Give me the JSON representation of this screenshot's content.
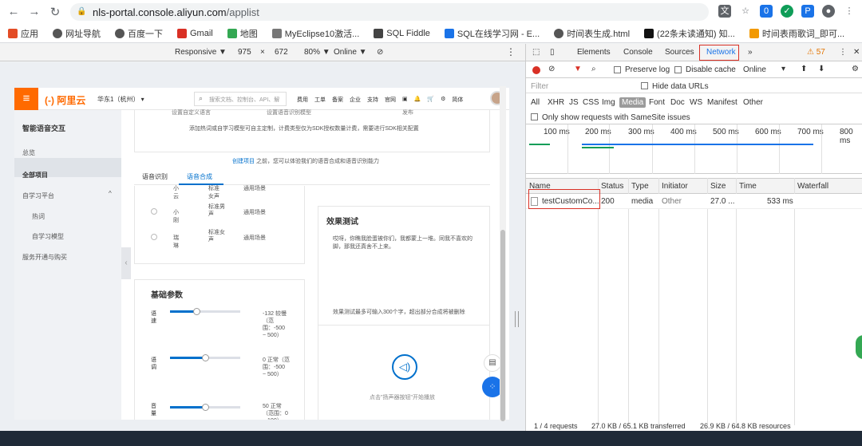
{
  "browser": {
    "url_host": "nls-portal.console.aliyun.com",
    "url_path": "/applist",
    "bookmarks": [
      "应用",
      "网址导航",
      "百度一下",
      "Gmail",
      "地图",
      "MyEclipse10激活...",
      "SQL Fiddle",
      "SQL在线学习网 - E...",
      "时间表生成.html",
      "(22条未读通知) 知...",
      "时间表雨歌词_即可..."
    ]
  },
  "device_toolbar": {
    "mode": "Responsive ▼",
    "width": "975",
    "height": "672",
    "zoom": "80% ▼",
    "network": "Online ▼"
  },
  "aliyun": {
    "logo": "(-) 阿里云",
    "region": "华东1（杭州）  ▾",
    "search_placeholder": "搜索文档、控制台、API、解",
    "menu": [
      "费用",
      "工单",
      "备案",
      "企业",
      "支持",
      "官网",
      "▣",
      "🔔",
      "🛒",
      "⚙",
      "简体"
    ],
    "sidebar": {
      "title": "智能语音交互",
      "items": [
        "总览",
        "全部项目",
        "自学习平台",
        "热词",
        "自学习模型",
        "服务开通与购买"
      ]
    },
    "notice_line1": [
      "设置自定义语言",
      "设置语音识别模型",
      "发布"
    ],
    "notice_line2": "添加热词或自学习模型可自主定制，计费类型仅为SDK授权数量计费，需要进行SDK相关配置",
    "hint_link": "创建项目",
    "hint_text": "之前，您可以体验我们的语音合成和语音识别能力",
    "tabs": [
      "语音识别",
      "语音合成"
    ],
    "voices": [
      {
        "name": "小云",
        "desc": "标准女声",
        "scene": "通用场景"
      },
      {
        "name": "小刚",
        "desc": "标准男声",
        "scene": "通用场景"
      },
      {
        "name": "瑞琳",
        "desc": "标准女声",
        "scene": "通用场景"
      }
    ],
    "params": {
      "title": "基础参数",
      "items": [
        {
          "label": "语速",
          "value": -132,
          "value_text": "-132 较慢（范围：-500 ~ 500）",
          "level": 0.37
        },
        {
          "label": "语调",
          "value": 0,
          "value_text": "0 正常（范围：-500 ~ 500）",
          "level": 0.5
        },
        {
          "label": "音量",
          "value": 50,
          "value_text": "50 正常（范围：0 ~ 100）",
          "level": 0.5
        }
      ]
    },
    "effect": {
      "title": "效果测试",
      "text": "哎呀，你瞧我脸蛋被你们，我都蒙上一堆。同我不喜欢的脚，那我还真舍不上来。",
      "limit": "效果测试最多可输入300个字，超出部分合成将被删除",
      "play_hint": "点击\"扬声器按钮\"开始播放"
    }
  },
  "devtools": {
    "tabs": [
      "Elements",
      "Console",
      "Sources",
      "Network",
      "»"
    ],
    "warnings": "⚠ 57",
    "preserve_log": "Preserve log",
    "disable_cache": "Disable cache",
    "throttle": "Online",
    "filter_placeholder": "Filter",
    "hide_data_urls": "Hide data URLs",
    "types": [
      "All",
      "XHR",
      "JS",
      "CSS",
      "Img",
      "Media",
      "Font",
      "Doc",
      "WS",
      "Manifest",
      "Other"
    ],
    "samesite": "Only show requests with SameSite issues",
    "timeline_labels": [
      "100 ms",
      "200 ms",
      "300 ms",
      "400 ms",
      "500 ms",
      "600 ms",
      "700 ms",
      "800 ms"
    ],
    "columns": [
      "Name",
      "Status",
      "Type",
      "Initiator",
      "Size",
      "Time",
      "Waterfall"
    ],
    "rows": [
      {
        "name": "testCustomCo...",
        "status": "200",
        "type": "media",
        "initiator": "Other",
        "size": "27.0 ...",
        "time": "533 ms"
      }
    ],
    "status_bar": [
      "1 / 4 requests",
      "27.0 KB / 65.1 KB transferred",
      "26.9 KB / 64.8 KB resources"
    ]
  }
}
